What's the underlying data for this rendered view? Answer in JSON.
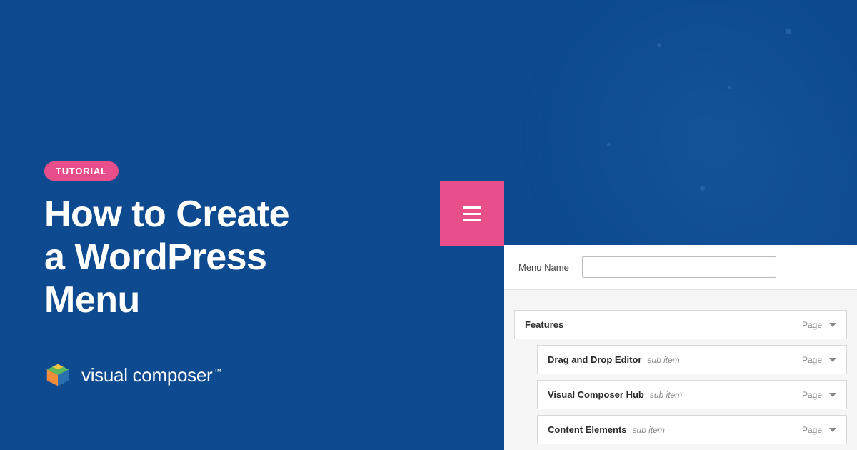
{
  "badge": "TUTORIAL",
  "title_line1": "How to Create",
  "title_line2": "a WordPress",
  "title_line3": "Menu",
  "brand": "visual composer",
  "panel": {
    "menu_name_label": "Menu Name",
    "menu_name_value": "",
    "items": [
      {
        "title": "Features",
        "sub": false,
        "type": "Page"
      },
      {
        "title": "Drag and Drop Editor",
        "sub": true,
        "type": "Page",
        "subtag": "sub item"
      },
      {
        "title": "Visual Composer Hub",
        "sub": true,
        "type": "Page",
        "subtag": "sub item"
      },
      {
        "title": "Content Elements",
        "sub": true,
        "type": "Page",
        "subtag": "sub item"
      }
    ]
  }
}
